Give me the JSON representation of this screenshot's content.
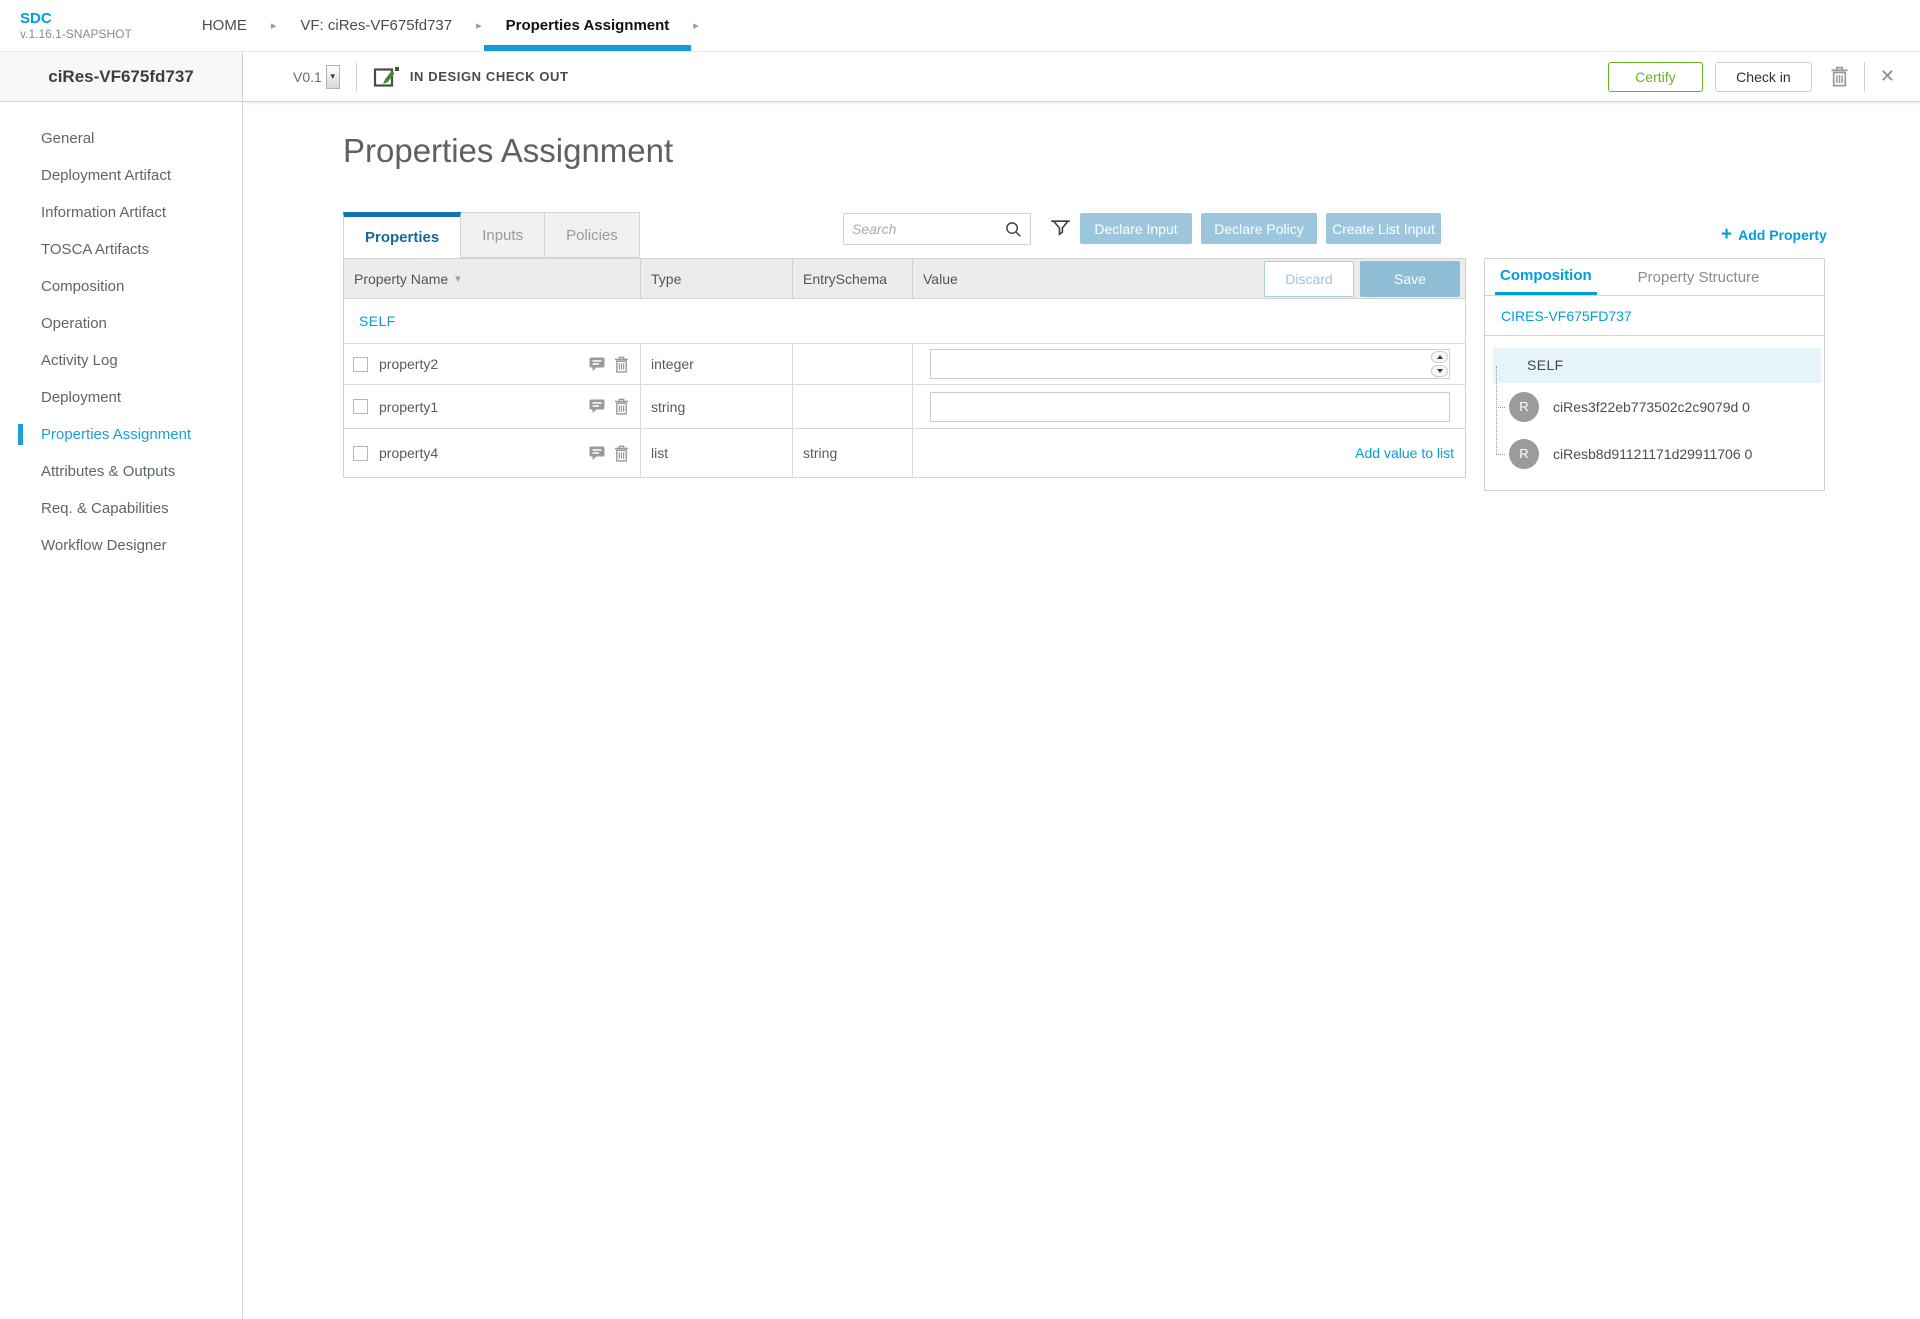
{
  "topbar": {
    "logo_title": "SDC",
    "logo_version": "v.1.16.1-SNAPSHOT",
    "breadcrumbs": [
      {
        "label": "HOME"
      },
      {
        "label": "VF: ciRes-VF675fd737"
      },
      {
        "label": "Properties Assignment"
      }
    ]
  },
  "header": {
    "entity_name": "ciRes-VF675fd737",
    "version": "V0.1",
    "status": "IN DESIGN CHECK OUT",
    "certify_label": "Certify",
    "checkin_label": "Check in"
  },
  "sidebar": {
    "items": [
      {
        "label": "General"
      },
      {
        "label": "Deployment Artifact"
      },
      {
        "label": "Information Artifact"
      },
      {
        "label": "TOSCA Artifacts"
      },
      {
        "label": "Composition"
      },
      {
        "label": "Operation"
      },
      {
        "label": "Activity Log"
      },
      {
        "label": "Deployment"
      },
      {
        "label": "Properties Assignment"
      },
      {
        "label": "Attributes & Outputs"
      },
      {
        "label": "Req. & Capabilities"
      },
      {
        "label": "Workflow Designer"
      }
    ],
    "active_item": "Properties Assignment"
  },
  "main": {
    "title": "Properties Assignment",
    "tabs": [
      "Properties",
      "Inputs",
      "Policies"
    ],
    "search_placeholder": "Search",
    "actions": [
      "Declare Input",
      "Declare Policy",
      "Create List Input"
    ],
    "add_property_label": "Add Property",
    "table": {
      "columns": [
        "Property Name",
        "Type",
        "EntrySchema",
        "Value"
      ],
      "discard_label": "Discard",
      "save_label": "Save",
      "group_label": "SELF",
      "rows": [
        {
          "name": "property2",
          "type": "integer",
          "entry_schema": "",
          "value": ""
        },
        {
          "name": "property1",
          "type": "string",
          "entry_schema": "",
          "value": ""
        },
        {
          "name": "property4",
          "type": "list",
          "entry_schema": "string",
          "link_label": "Add value to list"
        }
      ]
    }
  },
  "panel": {
    "tabs": [
      "Composition",
      "Property Structure"
    ],
    "component_name": "CIRES-VF675FD737",
    "tree": {
      "self_label": "SELF",
      "items": [
        {
          "avatar": "R",
          "label": "ciRes3f22eb773502c2c9079d 0"
        },
        {
          "avatar": "R",
          "label": "ciResb8d91121171d29911706 0"
        }
      ]
    }
  },
  "icons": {
    "breadcrumb_chevron": "▸",
    "dropdown_arrow": "▾",
    "sort_arrow": "▾",
    "plus": "+",
    "close": "✕"
  },
  "colors": {
    "accent": "#009fdb",
    "tab_active": "#1173b2",
    "action_button": "#9cc6dc",
    "save_button": "#8fbdd5",
    "certify_green": "#67b221",
    "tree_highlight": "#e6f4fa"
  }
}
